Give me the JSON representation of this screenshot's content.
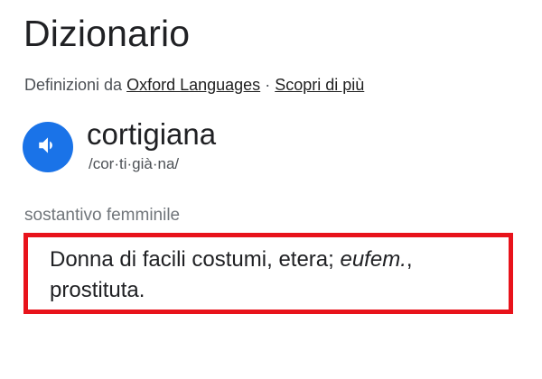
{
  "header": {
    "title": "Dizionario"
  },
  "source": {
    "prefix": "Definizioni da",
    "link_label": "Oxford Languages",
    "separator": "·",
    "more_label": "Scopri di più"
  },
  "entry": {
    "word": "cortigiana",
    "phonetic": "/cor·ti·già·na/",
    "speaker_icon": "volume-up-icon",
    "part_of_speech": "sostantivo femminile",
    "definition": {
      "text_start": "Donna di facili costumi, etera; ",
      "abbreviation": "eufem.",
      "text_end": ", prostituta."
    }
  },
  "colors": {
    "accent": "#1a73e8",
    "highlight_border": "#e8131b"
  }
}
